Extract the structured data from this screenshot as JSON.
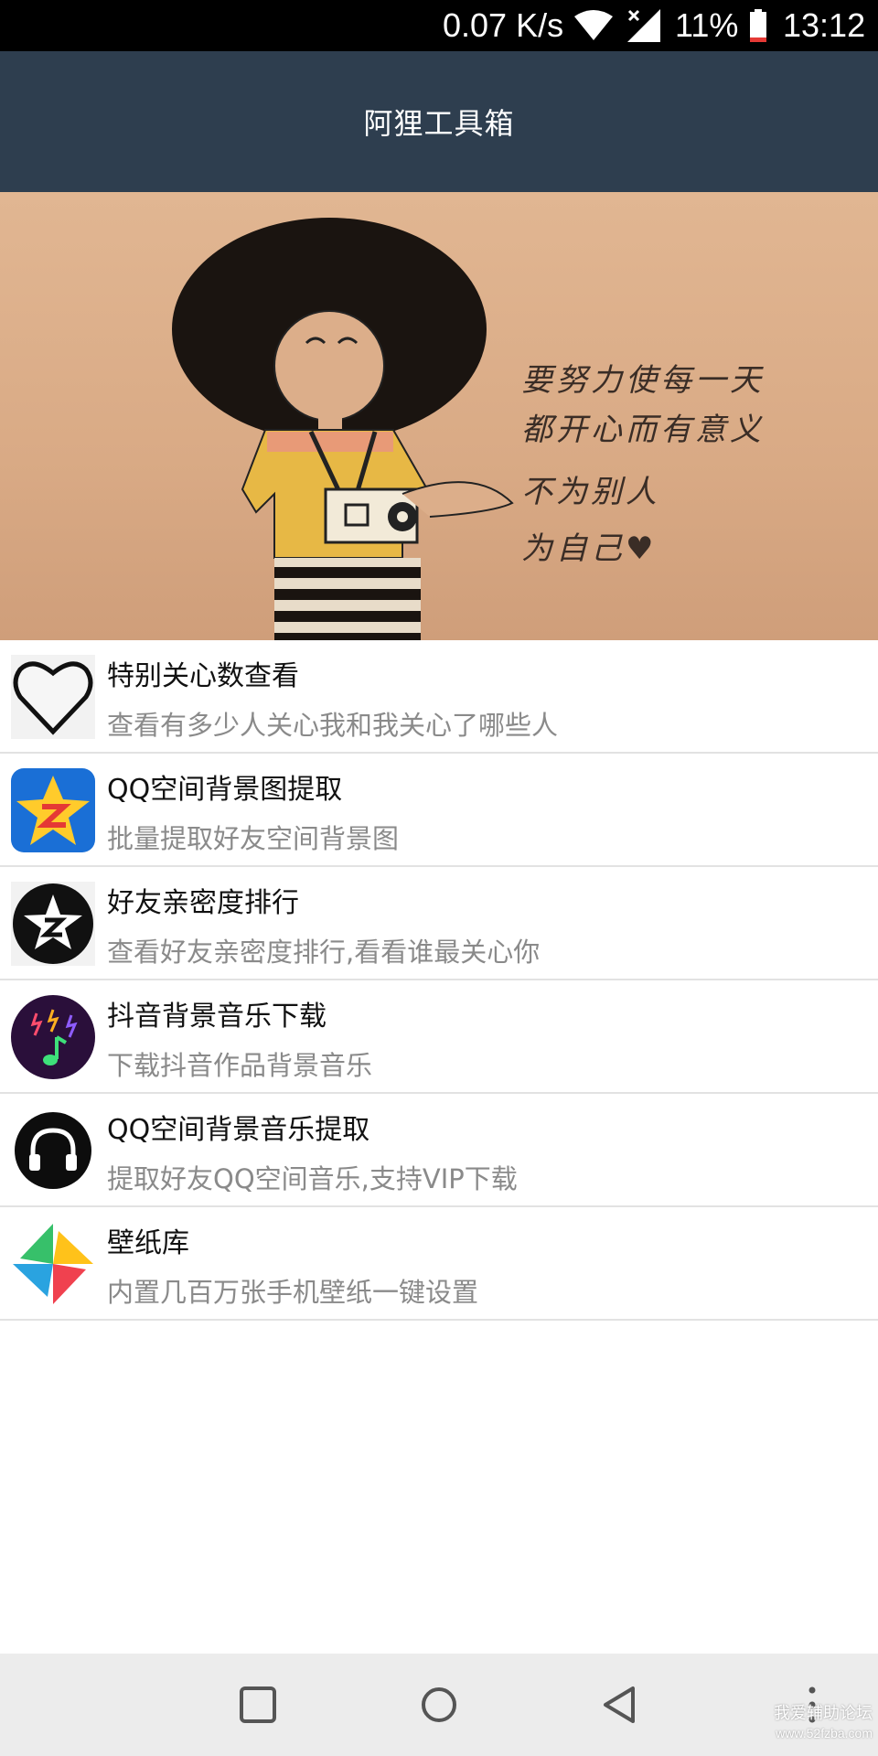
{
  "status_bar": {
    "speed": "0.07 K/s",
    "battery_percent": "11%",
    "time": "13:12"
  },
  "app_bar": {
    "title": "阿狸工具箱"
  },
  "banner": {
    "quote_lines": [
      "要努力使每一天",
      "都开心而有意义",
      "不为别人",
      "为自己♥"
    ]
  },
  "tools": [
    {
      "icon": "heart-icon",
      "title": "特别关心数查看",
      "subtitle": "查看有多少人关心我和我关心了哪些人"
    },
    {
      "icon": "qzone-star-icon",
      "title": "QQ空间背景图提取",
      "subtitle": "批量提取好友空间背景图"
    },
    {
      "icon": "qzone-badge-icon",
      "title": "好友亲密度排行",
      "subtitle": "查看好友亲密度排行,看看谁最关心你"
    },
    {
      "icon": "music-note-icon",
      "title": "抖音背景音乐下载",
      "subtitle": "下载抖音作品背景音乐"
    },
    {
      "icon": "headphones-icon",
      "title": "QQ空间背景音乐提取",
      "subtitle": "提取好友QQ空间音乐,支持VIP下载"
    },
    {
      "icon": "pinwheel-icon",
      "title": "壁纸库",
      "subtitle": "内置几百万张手机壁纸一键设置"
    }
  ],
  "watermark": {
    "line1": "我爱辅助论坛",
    "line2": "www.52fzba.com"
  },
  "colors": {
    "app_bar": "#2e3e4f",
    "status_bar": "#000000",
    "nav_bar": "#ececec",
    "subtitle": "#8a8a8a"
  }
}
